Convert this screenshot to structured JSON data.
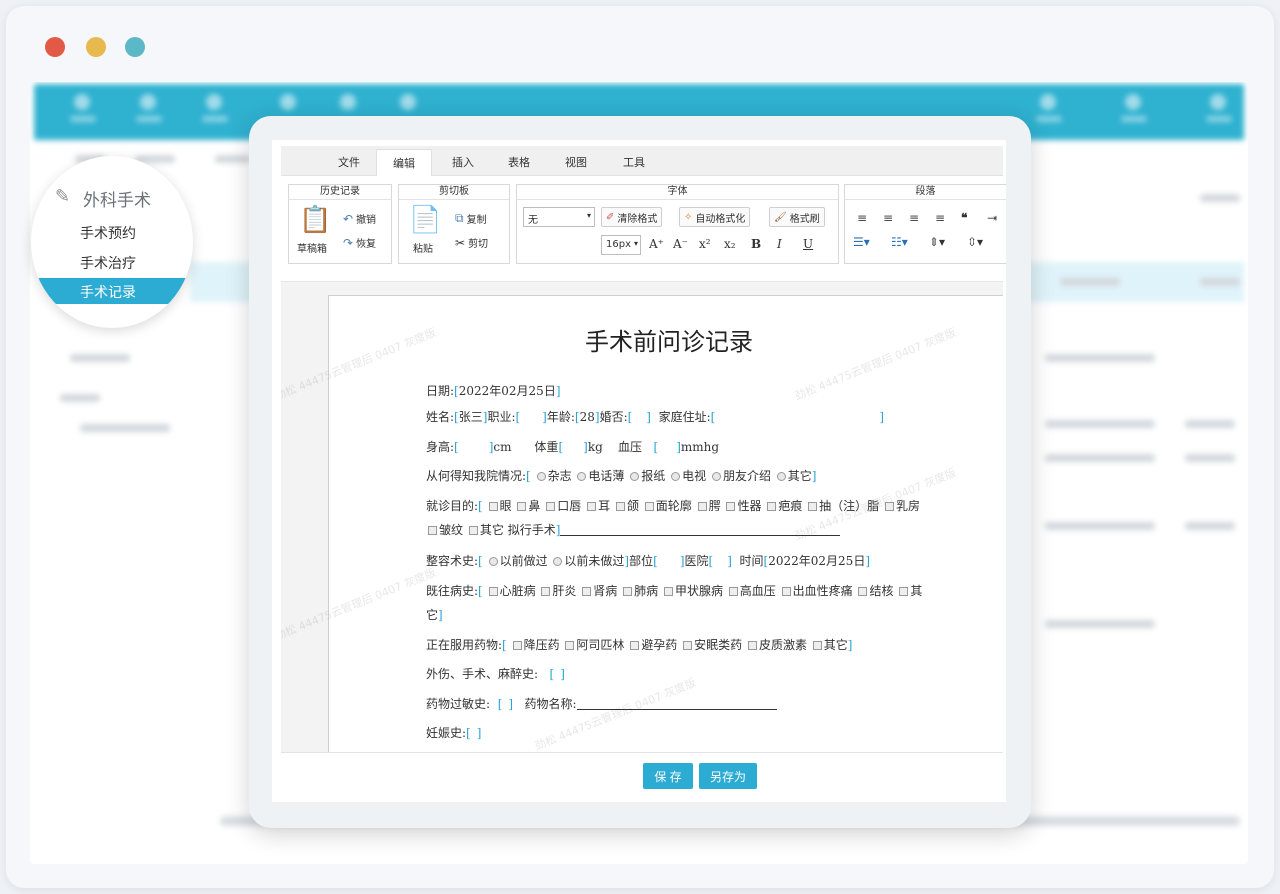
{
  "window": {
    "controls": [
      "close",
      "minimize",
      "maximize"
    ]
  },
  "sidebar": {
    "section_title": "外科手术",
    "items": [
      {
        "label": "手术预约"
      },
      {
        "label": "手术治疗"
      },
      {
        "label": "手术记录",
        "active": true
      }
    ]
  },
  "editor": {
    "menu_tabs": [
      "文件",
      "编辑",
      "插入",
      "表格",
      "视图",
      "工具"
    ],
    "active_tab": "编辑",
    "groups": {
      "history": {
        "title": "历史记录",
        "draft": "草稿箱",
        "undo": "撤销",
        "redo": "恢复"
      },
      "clipboard": {
        "title": "剪切板",
        "paste": "粘贴",
        "copy": "复制",
        "cut": "剪切"
      },
      "font": {
        "title": "字体",
        "font_select": "无",
        "clear_format": "清除格式",
        "auto_format": "自动格式化",
        "format_brush": "格式刷",
        "size": "16px"
      },
      "paragraph": {
        "title": "段落"
      }
    },
    "document": {
      "title": "手术前问诊记录",
      "date_label": "日期:",
      "date_value": "2022年02月25日",
      "name_label": "姓名:",
      "name_value": "张三",
      "job_label": "职业:",
      "age_label": "年龄:",
      "age_value": "28",
      "marriage_label": "婚否:",
      "address_label": "家庭住址:",
      "height_label": "身高:",
      "height_unit": "cm",
      "weight_label": "体重",
      "weight_unit": "kg",
      "bp_label": "血压",
      "bp_unit": "mmhg",
      "source_label": "从何得知我院情况:",
      "source_options": [
        "杂志",
        "电话薄",
        "报纸",
        "电视",
        "朋友介绍",
        "其它"
      ],
      "purpose_label": "就诊目的:",
      "purpose_options": [
        "眼",
        "鼻",
        "口唇",
        "耳",
        "颌",
        "面轮廓",
        "腭",
        "性器",
        "疤痕",
        "抽（注）脂",
        "乳房"
      ],
      "purpose_options_2": [
        "皱纹",
        "其它"
      ],
      "planned_label": "拟行手术",
      "cosmetic_label": "整容术史:",
      "cosmetic_options": [
        "以前做过",
        "以前未做过"
      ],
      "site_label": "部位",
      "hospital_label": "医院",
      "time_label": "时间",
      "time_value": "2022年02月25日",
      "history_label": "既往病史:",
      "history_options": [
        "心脏病",
        "肝炎",
        "肾病",
        "肺病",
        "甲状腺病",
        "高血压",
        "出血性疼痛",
        "结核",
        "其"
      ],
      "history_tail": "它",
      "meds_label": "正在服用药物:",
      "meds_options": [
        "降压药",
        "阿司匹林",
        "避孕药",
        "安眠类药",
        "皮质激素",
        "其它"
      ],
      "trauma_label": "外伤、手术、麻醉史:",
      "allergy_label": "药物过敏史:",
      "drug_name_label": "药物名称:",
      "pregnancy_label": "妊娠史:"
    },
    "watermark": "劲松 44475云管理后 0407 灰度版",
    "save_button": "保 存",
    "save_as_button": "另存为"
  }
}
